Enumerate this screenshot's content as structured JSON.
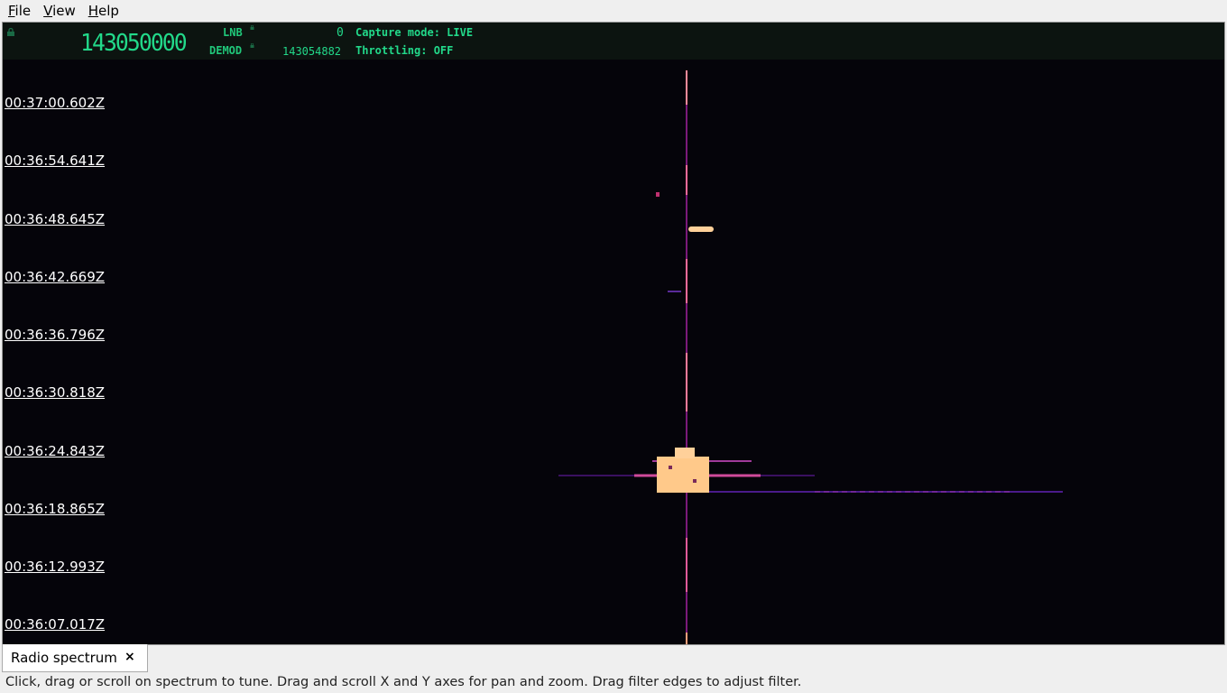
{
  "menu": {
    "items": [
      {
        "label": "File",
        "mnemonic": "F",
        "rest": "ile"
      },
      {
        "label": "View",
        "mnemonic": "V",
        "rest": "iew"
      },
      {
        "label": "Help",
        "mnemonic": "H",
        "rest": "elp"
      }
    ]
  },
  "status": {
    "frequency": "143050000",
    "lnb_label": "LNB",
    "lnb_value": "0",
    "demod_label": "DEMOD",
    "demod_value": "143054882",
    "capture_mode": "Capture mode: LIVE",
    "throttling": "Throttling: OFF"
  },
  "time_axis": {
    "labels": [
      "00:37:00.602Z",
      "00:36:54.641Z",
      "00:36:48.645Z",
      "00:36:42.669Z",
      "00:36:36.796Z",
      "00:36:30.818Z",
      "00:36:24.843Z",
      "00:36:18.865Z",
      "00:36:12.993Z",
      "00:36:07.017Z"
    ]
  },
  "tabs": [
    {
      "label": "Radio spectrum",
      "close_icon": "close-icon"
    }
  ],
  "hint": "Click, drag or scroll on spectrum to tune. Drag and scroll X and Y axes for pan and zoom. Drag filter edges to adjust filter.",
  "colors": {
    "background": "#05040a",
    "accent_green": "#22d98a",
    "signal_hot": "#ffc98a",
    "signal_mid": "#d0308a",
    "signal_low": "#5a1a8a"
  }
}
